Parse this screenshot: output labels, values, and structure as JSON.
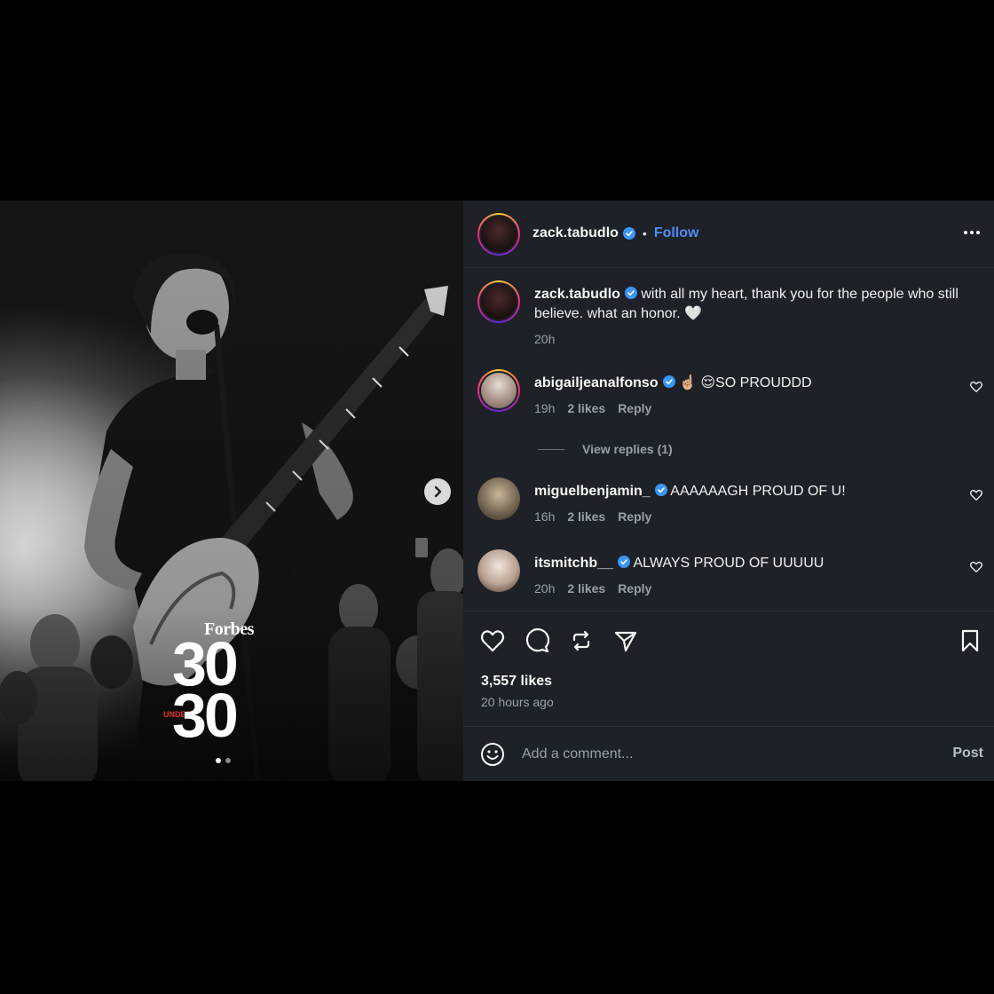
{
  "post": {
    "author": "zack.tabudlo",
    "follow_label": "Follow",
    "separator": "•",
    "caption": {
      "username": "zack.tabudlo",
      "text": "with all my heart, thank you for the people who still believe. what an honor.",
      "emoji": "🤍",
      "time": "20h"
    },
    "comments": [
      {
        "username": "abigailjeanalfonso",
        "emoji": "☝🏼 😌",
        "text": "SO PROUDDD",
        "time": "19h",
        "likes": "2 likes",
        "reply_label": "Reply"
      },
      {
        "username": "miguelbenjamin_",
        "emoji": "",
        "text": "AAAAAAGH PROUD OF U!",
        "time": "16h",
        "likes": "2 likes",
        "reply_label": "Reply"
      },
      {
        "username": "itsmitchb__",
        "emoji": "",
        "text": "ALWAYS PROUD OF UUUUU",
        "time": "20h",
        "likes": "2 likes",
        "reply_label": "Reply"
      }
    ],
    "view_replies": "View replies (1)",
    "likes_count": "3,557 likes",
    "posted_ago": "20 hours ago",
    "comment_placeholder": "Add a comment...",
    "post_label": "Post",
    "media": {
      "brand": "Forbes",
      "number_top": "30",
      "number_bottom": "30",
      "under_label": "UNDER",
      "slide_count": 2,
      "active_slide": 1
    },
    "icons": {
      "like": "heart-icon",
      "comment": "comment-icon",
      "repost": "repost-icon",
      "share": "share-icon",
      "save": "bookmark-icon",
      "emoji": "emoji-icon",
      "more": "more-icon",
      "next": "chevron-right-icon",
      "verified": "verified-badge-icon"
    },
    "colors": {
      "panel_bg": "#1e2127",
      "accent": "#4e8ef7",
      "verified": "#3b95f4",
      "under_red": "#e0332d"
    }
  }
}
